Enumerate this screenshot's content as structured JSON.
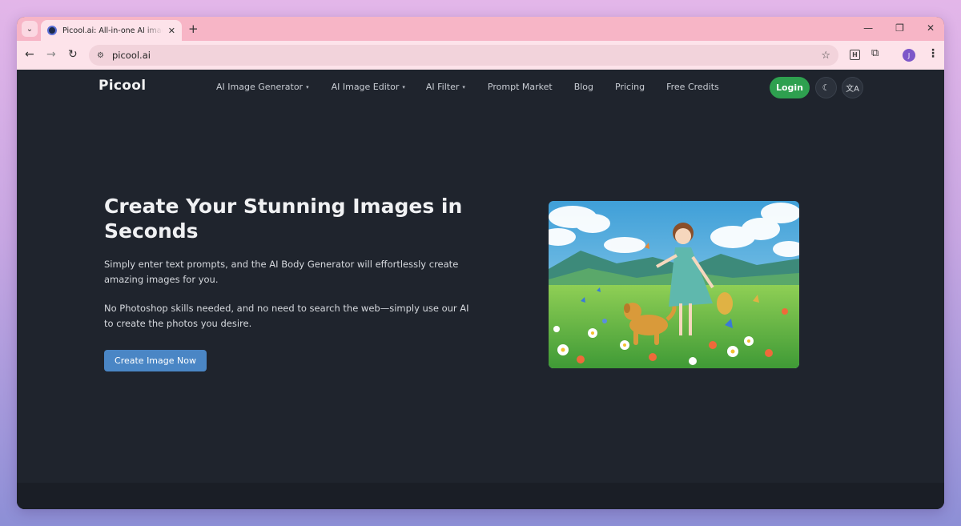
{
  "browser": {
    "tab_title": "Picool.ai: All-in-one AI image pr",
    "url": "picool.ai",
    "profile_initial": "J",
    "extension_label": "H"
  },
  "site": {
    "logo": "Picool",
    "nav": [
      {
        "label": "AI Image Generator",
        "dropdown": true
      },
      {
        "label": "AI Image Editor",
        "dropdown": true
      },
      {
        "label": "AI Filter",
        "dropdown": true
      },
      {
        "label": "Prompt Market",
        "dropdown": false
      },
      {
        "label": "Blog",
        "dropdown": false
      },
      {
        "label": "Pricing",
        "dropdown": false
      },
      {
        "label": "Free Credits",
        "dropdown": false
      }
    ],
    "login_label": "Login",
    "theme_icon": "moon-icon",
    "language_icon": "translate-icon"
  },
  "hero": {
    "title": "Create Your Stunning Images in Seconds",
    "paragraph1": "Simply enter text prompts, and the AI Body Generator will effortlessly create amazing images for you.",
    "paragraph2": "No Photoshop skills needed, and no need to search the web—simply use our AI to create the photos you desire.",
    "cta_label": "Create Image Now"
  },
  "colors": {
    "page_bg": "#1f242d",
    "login_green": "#2ea04f",
    "cta_blue": "#4a86c5",
    "tab_strip": "#f7b5c6"
  }
}
